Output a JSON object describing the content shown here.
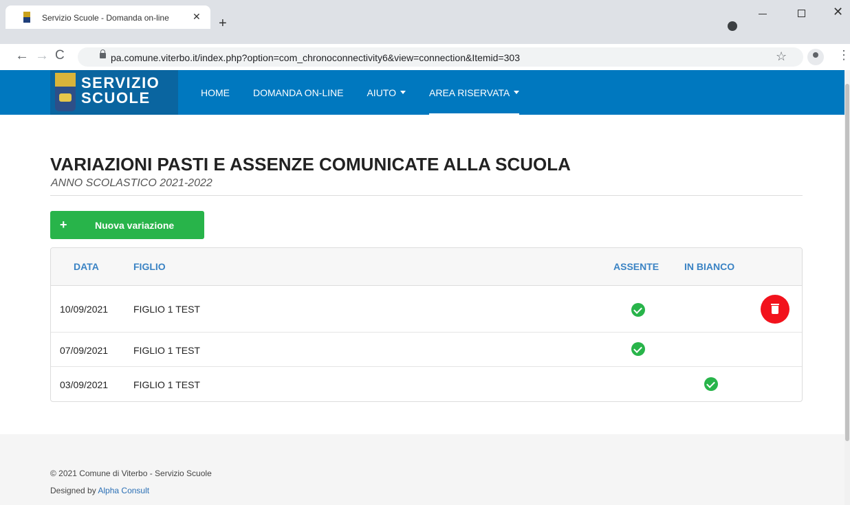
{
  "browser": {
    "tab_title": "Servizio Scuole - Domanda on-line",
    "tab_close": "✕",
    "new_tab": "+",
    "url": "pa.comune.viterbo.it/index.php?option=com_chronoconnectivity6&view=connection&Itemid=303",
    "back": "←",
    "forward": "→",
    "reload": "C",
    "star": "☆",
    "menu": "⋮",
    "close": "✕"
  },
  "site": {
    "logo_line1": "SERVIZIO",
    "logo_line2": "SCUOLE",
    "menu": [
      {
        "label": "HOME"
      },
      {
        "label": "DOMANDA ON-LINE"
      },
      {
        "label": "AIUTO"
      },
      {
        "label": "AREA RISERVATA"
      }
    ]
  },
  "main": {
    "title": "VARIAZIONI PASTI E ASSENZE COMUNICATE ALLA SCUOLA",
    "subtitle": "ANNO SCOLASTICO 2021-2022",
    "new_button_icon": "+",
    "new_button_label": "Nuova variazione",
    "columns": {
      "data": "DATA",
      "figlio": "FIGLIO",
      "assente": "ASSENTE",
      "in_bianco": "IN BIANCO"
    },
    "rows": [
      {
        "data": "10/09/2021",
        "figlio": "FIGLIO 1 TEST",
        "assente": true,
        "in_bianco": false,
        "deletable": true
      },
      {
        "data": "07/09/2021",
        "figlio": "FIGLIO 1 TEST",
        "assente": true,
        "in_bianco": false,
        "deletable": false
      },
      {
        "data": "03/09/2021",
        "figlio": "FIGLIO 1 TEST",
        "assente": false,
        "in_bianco": true,
        "deletable": false
      }
    ]
  },
  "footer": {
    "copyright": "© 2021 Comune di Viterbo - Servizio Scuole",
    "designed_by": "Designed by",
    "designer": "Alpha Consult"
  },
  "colors": {
    "navbar": "#0078bf",
    "accent_green": "#28b44a",
    "delete_red": "#f2121c",
    "header_text": "#3a83c4"
  }
}
